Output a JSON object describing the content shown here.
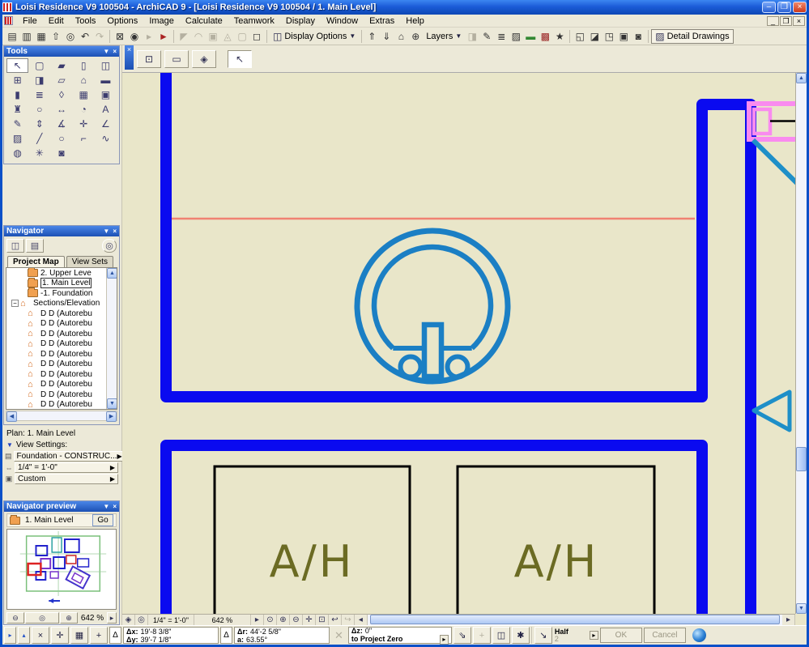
{
  "titlebar": {
    "title": "Loisi Residence V9 100504 - ArchiCAD 9 - [Loisi Residence V9 100504 / 1. Main Level]",
    "minimize": "–",
    "restore": "❐",
    "close": "×"
  },
  "menubar": {
    "items": [
      "File",
      "Edit",
      "Tools",
      "Options",
      "Image",
      "Calculate",
      "Teamwork",
      "Display",
      "Window",
      "Extras",
      "Help"
    ],
    "child_minimize": "_",
    "child_restore": "❐",
    "child_close": "×"
  },
  "toolbar": {
    "icons": [
      {
        "name": "save-icon",
        "glyph": "▤"
      },
      {
        "name": "save-all-icon",
        "glyph": "▥"
      },
      {
        "name": "print-icon",
        "glyph": "▦"
      },
      {
        "name": "publisher-icon",
        "glyph": "⇧"
      },
      {
        "name": "find-select-icon",
        "glyph": "◎"
      },
      {
        "name": "undo-icon",
        "glyph": "↶"
      },
      {
        "name": "redo-icon",
        "glyph": "↷"
      },
      {
        "name": "fit-in-window-icon",
        "glyph": "⊠"
      },
      {
        "name": "zoom-icon",
        "glyph": "◉"
      },
      {
        "name": "pointer-icon",
        "glyph": "▸"
      },
      {
        "name": "marker-icon",
        "glyph": "►"
      },
      {
        "name": "trim-icon",
        "glyph": "◤"
      },
      {
        "name": "fillet-icon",
        "glyph": "◠"
      },
      {
        "name": "group-icon",
        "glyph": "▣"
      },
      {
        "name": "explode-icon",
        "glyph": "◬"
      },
      {
        "name": "ungroup-icon",
        "glyph": "▢"
      },
      {
        "name": "selection-frame-icon",
        "glyph": "◻"
      }
    ],
    "display_options": {
      "icon": "◫",
      "label": "Display Options",
      "arrow": "▼"
    },
    "mid_icons": [
      {
        "name": "story-up-icon",
        "glyph": "⇑"
      },
      {
        "name": "story-down-icon",
        "glyph": "⇓"
      },
      {
        "name": "story-settings-icon",
        "glyph": "⌂"
      },
      {
        "name": "navigate-icon",
        "glyph": "⊕"
      }
    ],
    "layers": {
      "label": "Layers",
      "arrow": "▼"
    },
    "right_icons": [
      {
        "name": "quick-layers-icon",
        "glyph": "◨"
      },
      {
        "name": "pen-color-icon",
        "glyph": "✎"
      },
      {
        "name": "line-type-icon",
        "glyph": "≣"
      },
      {
        "name": "fill-type-icon",
        "glyph": "▨"
      },
      {
        "name": "surface-icon",
        "glyph": "▬"
      },
      {
        "name": "composite-icon",
        "glyph": "▩"
      },
      {
        "name": "favorites-icon",
        "glyph": "★"
      },
      {
        "name": "new-window-icon",
        "glyph": "◱"
      },
      {
        "name": "profile-icon",
        "glyph": "◪"
      },
      {
        "name": "3d-window-icon",
        "glyph": "◳"
      },
      {
        "name": "photo-icon",
        "glyph": "▣"
      },
      {
        "name": "render-icon",
        "glyph": "◙"
      }
    ],
    "detail_drawings": {
      "icon": "▨",
      "label": "Detail Drawings"
    }
  },
  "tools_palette": {
    "title": "Tools",
    "tools": [
      {
        "name": "arrow-tool",
        "glyph": "↖"
      },
      {
        "name": "marquee-tool",
        "glyph": "▢"
      },
      {
        "name": "wall-tool",
        "glyph": "▰"
      },
      {
        "name": "column-tool",
        "glyph": "▯"
      },
      {
        "name": "door-tool",
        "glyph": "◫"
      },
      {
        "name": "window-tool",
        "glyph": "⊞"
      },
      {
        "name": "skylight-tool",
        "glyph": "◨"
      },
      {
        "name": "slab-tool",
        "glyph": "▱"
      },
      {
        "name": "roof-tool",
        "glyph": "⌂"
      },
      {
        "name": "beam-tool",
        "glyph": "▬"
      },
      {
        "name": "column2-tool",
        "glyph": "▮"
      },
      {
        "name": "stair-tool",
        "glyph": "≣"
      },
      {
        "name": "shell-tool",
        "glyph": "◊"
      },
      {
        "name": "mesh-tool",
        "glyph": "▦"
      },
      {
        "name": "zone-tool",
        "glyph": "▣"
      },
      {
        "name": "object-tool",
        "glyph": "♜"
      },
      {
        "name": "lamp-tool",
        "glyph": "○"
      },
      {
        "name": "dimension-tool",
        "glyph": "↔"
      },
      {
        "name": "radial-dimension-tool",
        "glyph": "◔"
      },
      {
        "name": "text-tool",
        "glyph": "A"
      },
      {
        "name": "label-tool",
        "glyph": "✎"
      },
      {
        "name": "level-dimension-tool",
        "glyph": "⇕"
      },
      {
        "name": "angle-dimension-tool",
        "glyph": "∡"
      },
      {
        "name": "elevation-dimension-tool",
        "glyph": "✛"
      },
      {
        "name": "angle-tool",
        "glyph": "∠"
      },
      {
        "name": "fill-tool",
        "glyph": "▨"
      },
      {
        "name": "line-tool",
        "glyph": "╱"
      },
      {
        "name": "circle-tool",
        "glyph": "○"
      },
      {
        "name": "polyline-tool",
        "glyph": "⌐"
      },
      {
        "name": "spline-tool",
        "glyph": "∿"
      },
      {
        "name": "camera-vr-tool",
        "glyph": "◍"
      },
      {
        "name": "hotspot-tool",
        "glyph": "✳"
      },
      {
        "name": "camera-tool",
        "glyph": "◙"
      }
    ]
  },
  "drawing_window": {
    "close_glyph": "×",
    "mini_buttons": [
      {
        "name": "marquee-method-button",
        "glyph": "⊡"
      },
      {
        "name": "geometry-method-button",
        "glyph": "▭"
      },
      {
        "name": "eraser-button",
        "glyph": "◈"
      },
      {
        "name": "arrow-method-button",
        "glyph": "↖"
      }
    ]
  },
  "navigator": {
    "title": "Navigator",
    "nav_buttons": [
      {
        "name": "project-chooser-button",
        "glyph": "◫"
      },
      {
        "name": "folder-view-button",
        "glyph": "▤"
      },
      {
        "name": "find-view-button",
        "glyph": "◎"
      }
    ],
    "tabs": [
      {
        "label": "Project Map"
      },
      {
        "label": "View Sets"
      }
    ],
    "tree": [
      {
        "label": "2. Upper Leve"
      },
      {
        "label": "1. Main Level"
      },
      {
        "label": "-1. Foundation"
      },
      {
        "label": "Sections/Elevation"
      },
      {
        "label": "D D (Autorebu"
      },
      {
        "label": "D D (Autorebu"
      },
      {
        "label": "D D (Autorebu"
      },
      {
        "label": "D D (Autorebu"
      },
      {
        "label": "D D (Autorebu"
      },
      {
        "label": "D D (Autorebu"
      },
      {
        "label": "D D (Autorebu"
      },
      {
        "label": "D D (Autorebu"
      },
      {
        "label": "D D (Autorebu"
      },
      {
        "label": "D D (Autorebu"
      }
    ],
    "plan_label": "Plan: 1. Main Level",
    "view_settings_label": "View Settings:",
    "settings": [
      {
        "label": "Foundation - CONSTRUC..."
      },
      {
        "label": "1/4\"  =  1'-0\""
      },
      {
        "label": "Custom"
      }
    ]
  },
  "navigator_preview": {
    "title": "Navigator preview",
    "current_item": "1. Main Level",
    "go_label": "Go",
    "zoom_out_glyph": "⊖",
    "fit_glyph": "◎",
    "zoom_in_glyph": "⊕",
    "zoom_value": "642 %",
    "expand_glyph": "▸"
  },
  "canvas_bar": {
    "page_glyph": "◈",
    "doc_zoom_glyph": "◎",
    "scale": "1/4\"  =  1'-0\"",
    "zoom": "642 %",
    "buttons": [
      {
        "name": "dynamic-zoom-button",
        "glyph": "⊙"
      },
      {
        "name": "zoom-in-button",
        "glyph": "⊕"
      },
      {
        "name": "zoom-out-button",
        "glyph": "⊖"
      },
      {
        "name": "pan-button",
        "glyph": "✛"
      },
      {
        "name": "fit-button",
        "glyph": "⊡"
      },
      {
        "name": "previous-zoom-button",
        "glyph": "↩"
      },
      {
        "name": "next-zoom-button",
        "glyph": "↪",
        "disabled": true
      },
      {
        "name": "scroll-left-button",
        "glyph": "◂"
      }
    ]
  },
  "drawing": {
    "room_label": "A/H",
    "colors": {
      "background": "#e9e6c9",
      "wall": "#0a0af0",
      "fixture": "#1b7fc4",
      "marker_line": "#f08272",
      "door": "#f98bef",
      "section": "#1e8fc8",
      "room_border": "#000000",
      "room_text": "#6b6b23"
    }
  },
  "statusbar": {
    "dock_buttons": [
      {
        "name": "dock-button-1",
        "glyph": "▸"
      },
      {
        "name": "dock-button-2",
        "glyph": "▴"
      }
    ],
    "tool_buttons": [
      {
        "name": "cancel-input-button",
        "glyph": "×"
      },
      {
        "name": "tracking-button",
        "glyph": "✛"
      },
      {
        "name": "grid-snap-button",
        "glyph": "▦"
      },
      {
        "name": "relative-origin-button",
        "glyph": "+"
      }
    ],
    "delta_glyph": "Δ",
    "dx_label": "Δx:",
    "dx_value": "19'-8 3/8\"",
    "dy_label": "Δy:",
    "dy_value": "39'-7 1/8\"",
    "dr_label": "Δr:",
    "dr_value": "44'-2 5/8\"",
    "a_label": "a:",
    "a_value": "63.55°",
    "gray_x_glyph": "✕",
    "dz_label": "Δz:",
    "dz_value": "0\"",
    "reference_label": "to Project Zero",
    "edit_buttons": [
      {
        "name": "gravity-button",
        "glyph": "⇘"
      },
      {
        "name": "plane-snap-button",
        "glyph": "+",
        "disabled": true
      },
      {
        "name": "pet-palette-button",
        "glyph": "◫"
      },
      {
        "name": "magic-wand-button",
        "glyph": "✱"
      }
    ],
    "half_icon_glyph": "↘",
    "half_label": "Half",
    "half_value": "2",
    "ok_label": "OK",
    "cancel_label": "Cancel"
  }
}
